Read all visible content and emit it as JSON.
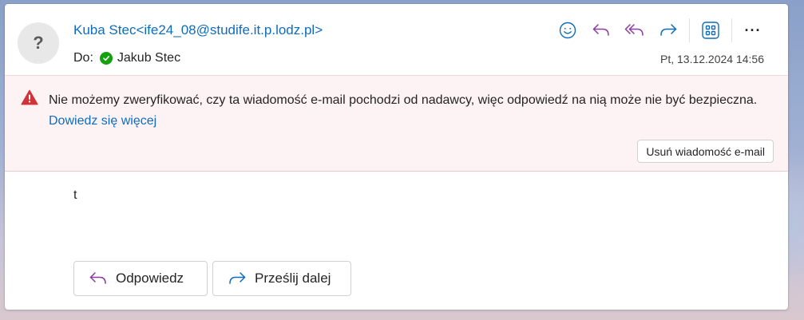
{
  "sender": {
    "display": "Kuba Stec<ife24_08@studife.it.p.lodz.pl>",
    "avatar_glyph": "?"
  },
  "recipients": {
    "label": "Do:",
    "name": "Jakub Stec",
    "status_color": "#13a10e"
  },
  "date": "Pt, 13.12.2024 14:56",
  "toolbar": {
    "icons": [
      "emoji-icon",
      "reply-icon",
      "reply-all-icon",
      "forward-icon",
      "apps-icon",
      "more-icon"
    ],
    "more_label": "···"
  },
  "warning": {
    "text": "Nie możemy zweryfikować, czy ta wiadomość e-mail pochodzi od nadawcy, więc odpowiedź na nią może nie być bezpieczna.",
    "link": "Dowiedz się więcej",
    "delete_label": "Usuń wiadomość e-mail"
  },
  "body": {
    "text": "t"
  },
  "actions": {
    "reply_label": "Odpowiedz",
    "forward_label": "Prześlij dalej"
  },
  "colors": {
    "accent": "#0f6cbd",
    "purple": "#8b3aa6",
    "warning_red": "#d13438",
    "warning_bg": "#fdf3f4"
  }
}
